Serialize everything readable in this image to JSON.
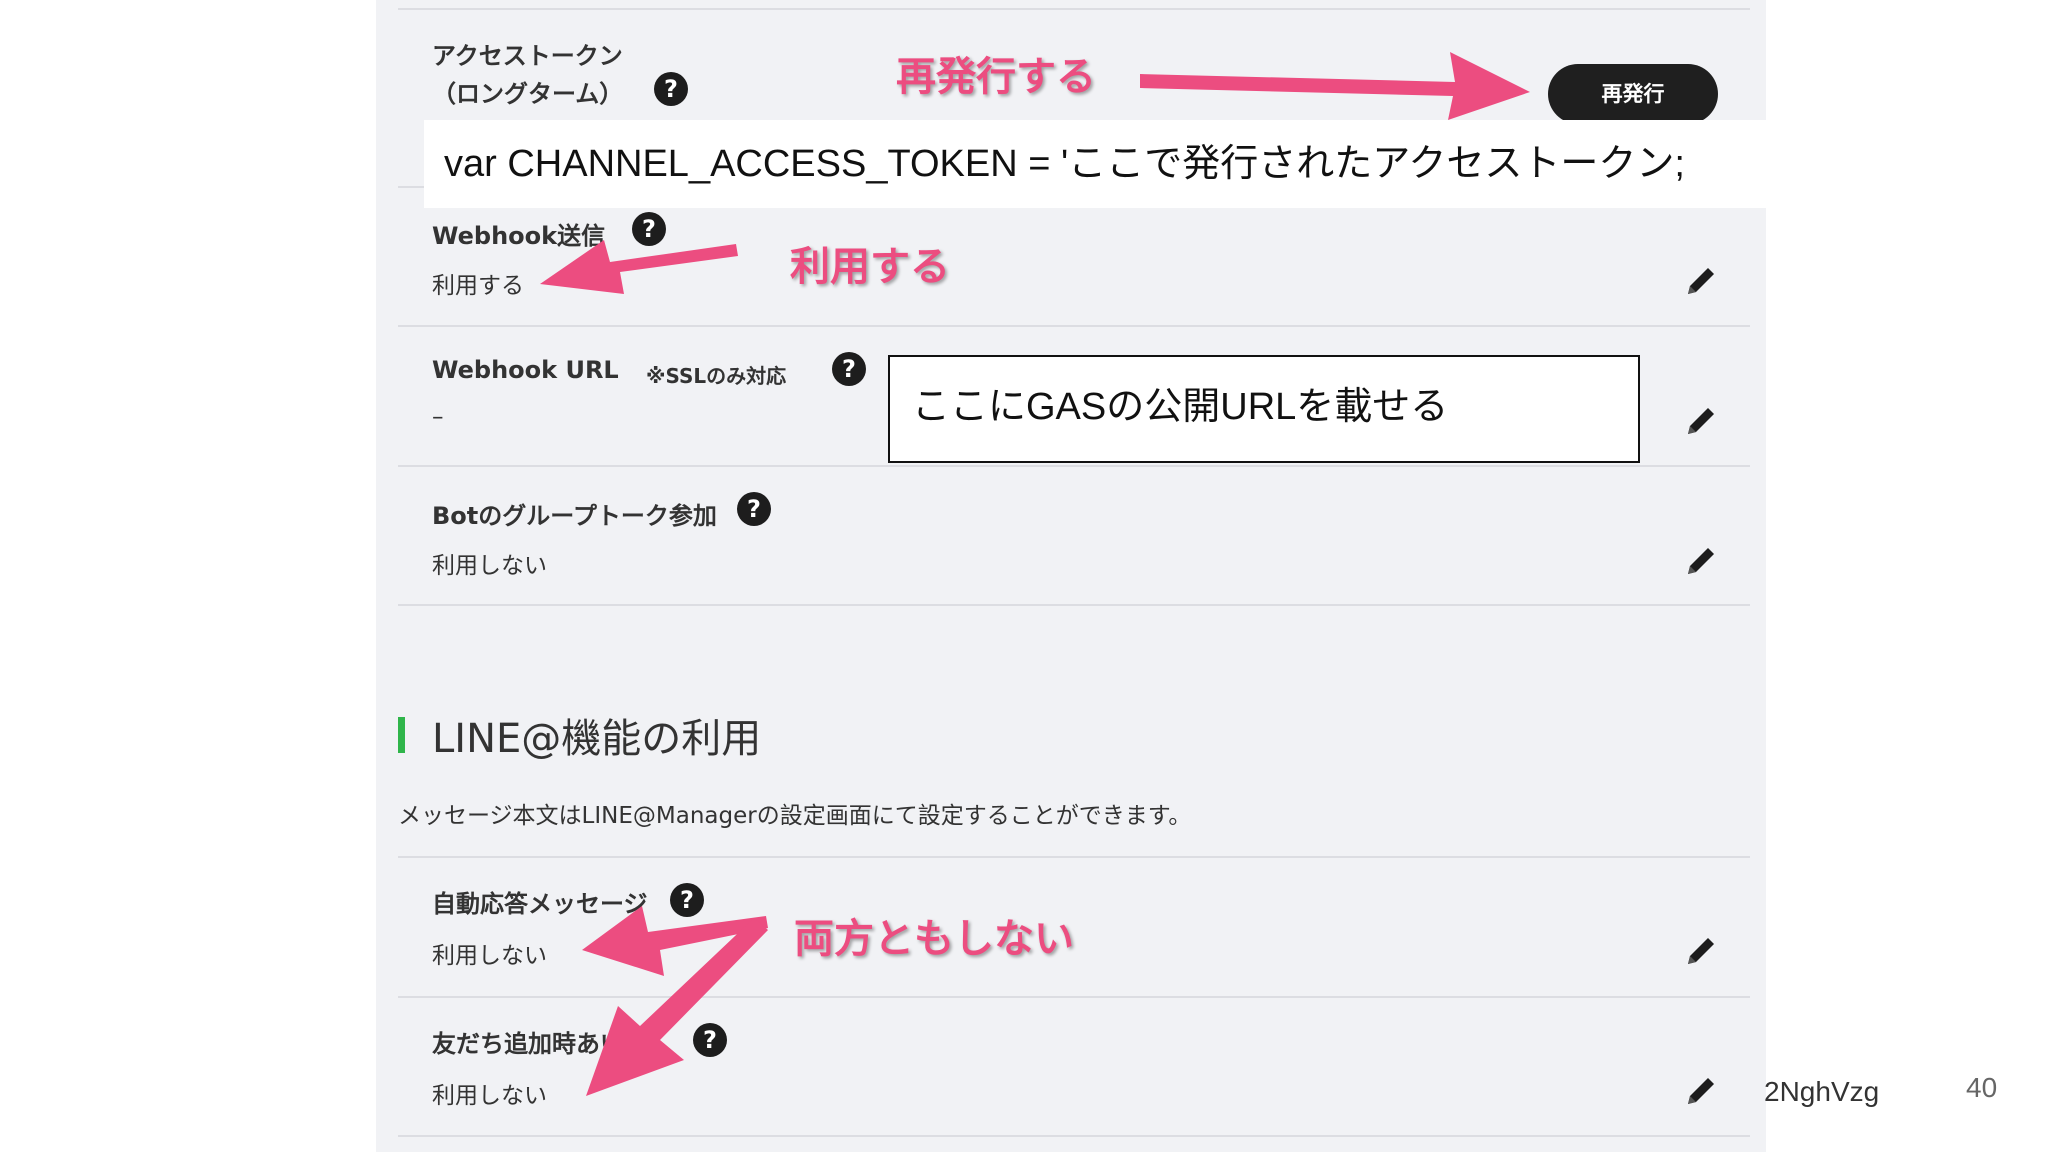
{
  "settings": {
    "access_token": {
      "label_line1": "アクセストークン",
      "label_line2": "（ロングターム）",
      "reissue_button": "再発行"
    },
    "webhook_send": {
      "label": "Webhook送信",
      "value": "利用する"
    },
    "webhook_url": {
      "label": "Webhook URL",
      "note": "※SSLのみ対応",
      "value": "–"
    },
    "bot_group": {
      "label": "Botのグループトーク参加",
      "value": "利用しない"
    },
    "line_at_section": {
      "title": "LINE@機能の利用",
      "description": "メッセージ本文はLINE@Managerの設定画面にて設定することができます。",
      "auto_reply": {
        "label": "自動応答メッセージ",
        "value": "利用しない"
      },
      "friend_add": {
        "label": "友だち追加時あい",
        "value": "利用しない"
      }
    },
    "help_glyph": "?"
  },
  "annotations": {
    "reissue": "再発行する",
    "use": "利用する",
    "neither": "両方ともしない",
    "code_line": "var CHANNEL_ACCESS_TOKEN = 'ここで発行されたアクセストークン;",
    "url_note": "ここにGASの公開URLを載せる"
  },
  "footer": {
    "url_fragment": "2NghVzg",
    "page_number": "40"
  },
  "colors": {
    "annotation_pink": "#ec4d80",
    "section_green": "#2fb54a",
    "button_dark": "#1f1f1f",
    "panel_bg": "#f1f2f5"
  },
  "icons": {
    "help": "question-circle-icon",
    "edit": "pencil-icon"
  }
}
